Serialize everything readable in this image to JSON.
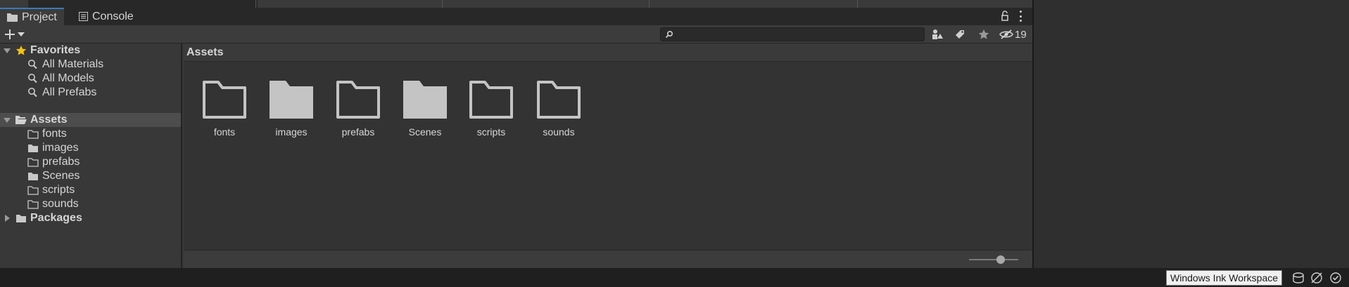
{
  "tabs": [
    {
      "label": "Project",
      "icon": "folder-icon",
      "active": true
    },
    {
      "label": "Console",
      "icon": "console-icon",
      "active": false
    }
  ],
  "toolbar": {
    "create_icon": "plus-icon",
    "search_placeholder": "",
    "hidden_count": "19"
  },
  "sidebar": {
    "favorites": {
      "label": "Favorites",
      "items": [
        "All Materials",
        "All Models",
        "All Prefabs"
      ]
    },
    "assets": {
      "label": "Assets",
      "children": [
        {
          "label": "fonts",
          "filled": false
        },
        {
          "label": "images",
          "filled": true
        },
        {
          "label": "prefabs",
          "filled": false
        },
        {
          "label": "Scenes",
          "filled": true
        },
        {
          "label": "scripts",
          "filled": false
        },
        {
          "label": "sounds",
          "filled": false
        }
      ]
    },
    "packages": {
      "label": "Packages"
    }
  },
  "main": {
    "breadcrumb": "Assets",
    "items": [
      {
        "label": "fonts",
        "filled": false
      },
      {
        "label": "images",
        "filled": true
      },
      {
        "label": "prefabs",
        "filled": false
      },
      {
        "label": "Scenes",
        "filled": true
      },
      {
        "label": "scripts",
        "filled": false
      },
      {
        "label": "sounds",
        "filled": false
      }
    ]
  },
  "taskbar": {
    "ink_workspace": "Windows Ink Workspace"
  },
  "colors": {
    "accent": "#3a79bb",
    "folder": "#c4c4c4"
  }
}
